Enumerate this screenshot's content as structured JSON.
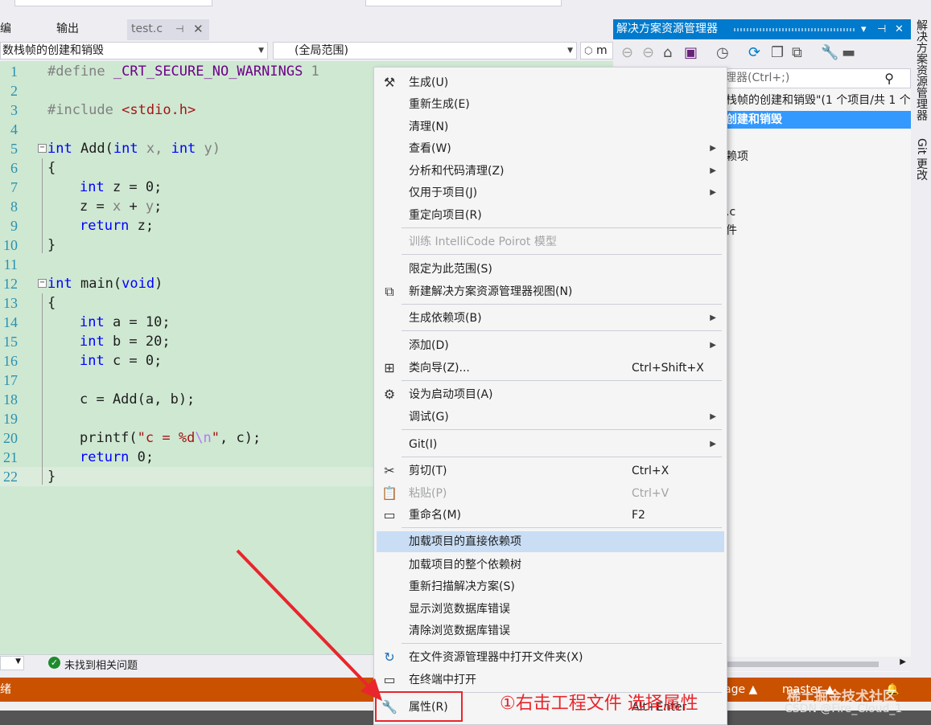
{
  "tabs": {
    "left_partial": "编",
    "output": "输出",
    "active": "test.c",
    "pin_icon": "pin-icon",
    "close_icon": "close-icon"
  },
  "navbar": {
    "project_combo": "数栈帧的创建和销毁",
    "scope_combo": "(全局范围)",
    "member_combo_partial": "m"
  },
  "editor": {
    "lines": [
      {
        "n": "1"
      },
      {
        "n": "2"
      },
      {
        "n": "3"
      },
      {
        "n": "4"
      },
      {
        "n": "5"
      },
      {
        "n": "6"
      },
      {
        "n": "7"
      },
      {
        "n": "8"
      },
      {
        "n": "9"
      },
      {
        "n": "10"
      },
      {
        "n": "11"
      },
      {
        "n": "12"
      },
      {
        "n": "13"
      },
      {
        "n": "14"
      },
      {
        "n": "15"
      },
      {
        "n": "16"
      },
      {
        "n": "17"
      },
      {
        "n": "18"
      },
      {
        "n": "19"
      },
      {
        "n": "20"
      },
      {
        "n": "21"
      },
      {
        "n": "22"
      }
    ],
    "tokens": {
      "define": "#define",
      "macro": "_CRT_SECURE_NO_WARNINGS",
      "one": " 1",
      "include": "#include",
      "header": "<stdio.h>",
      "int": "int",
      "return": "return",
      "void": "void",
      "add_sig_a": " Add(",
      "add_sig_x": " x, ",
      "add_sig_y": " y)",
      "brace_open": "{",
      "brace_close": "}",
      "l7_rest": " z = 0;",
      "l8": "z = ",
      "l8_x": "x",
      "l8_plus": " + ",
      "l8_y": "y",
      "l8_end": ";",
      "l9_rest": " z;",
      "main_a": " main(",
      "main_b": ")",
      "l14_rest": " a = 10;",
      "l15_rest": " b = 20;",
      "l16_rest": " c = 0;",
      "l18": "c = Add(a, b);",
      "l20_a": "printf(",
      "l20_str1": "\"c = %d",
      "l20_esc": "\\n",
      "l20_str2": "\"",
      "l20_b": ", c);",
      "l21_rest": " 0;"
    }
  },
  "editor_bottom": {
    "issues": "未找到相关问题"
  },
  "solution_explorer": {
    "title": "解决方案资源管理器",
    "title_controls": [
      "▾",
      "⊣",
      "✕"
    ],
    "search_placeholder": "理器(Ctrl+;)",
    "rows": [
      "栈帧的创建和销毁\"(1 个项目/共 1 个)",
      "创建和销毁",
      "赖项",
      ".c",
      "件"
    ]
  },
  "vertical_tabs": {
    "solution": "解决方案资源管理器",
    "git": "Git 更改"
  },
  "context_menu": {
    "items": [
      {
        "label": "生成(U)",
        "icon": "build-icon"
      },
      {
        "label": "重新生成(E)"
      },
      {
        "label": "清理(N)"
      },
      {
        "label": "查看(W)",
        "submenu": true
      },
      {
        "label": "分析和代码清理(Z)",
        "submenu": true
      },
      {
        "label": "仅用于项目(J)",
        "submenu": true
      },
      {
        "label": "重定向项目(R)"
      },
      {
        "label": "训练 IntelliCode Poirot 模型",
        "disabled": true
      },
      {
        "label": "限定为此范围(S)"
      },
      {
        "label": "新建解决方案资源管理器视图(N)",
        "icon": "new-view-icon"
      },
      {
        "label": "生成依赖项(B)",
        "submenu": true
      },
      {
        "label": "添加(D)",
        "submenu": true
      },
      {
        "label": "类向导(Z)...",
        "shortcut": "Ctrl+Shift+X",
        "icon": "class-wizard-icon"
      },
      {
        "label": "设为启动项目(A)",
        "icon": "gear-icon"
      },
      {
        "label": "调试(G)",
        "submenu": true
      },
      {
        "label": "Git(I)",
        "submenu": true
      },
      {
        "label": "剪切(T)",
        "shortcut": "Ctrl+X",
        "icon": "scissors-icon"
      },
      {
        "label": "粘贴(P)",
        "shortcut": "Ctrl+V",
        "disabled": true,
        "icon": "paste-icon"
      },
      {
        "label": "重命名(M)",
        "shortcut": "F2",
        "icon": "rename-icon"
      },
      {
        "label": "加载项目的直接依赖项",
        "highlighted": true
      },
      {
        "label": "加载项目的整个依赖树"
      },
      {
        "label": "重新扫描解决方案(S)"
      },
      {
        "label": "显示浏览数据库错误"
      },
      {
        "label": "清除浏览数据库错误"
      },
      {
        "label": "在文件资源管理器中打开文件夹(X)",
        "icon": "open-folder-icon"
      },
      {
        "label": "在终端中打开",
        "icon": "terminal-icon"
      },
      {
        "label": "属性(R)",
        "shortcut": "Alt+Enter",
        "icon": "wrench-icon"
      }
    ]
  },
  "statusbar": {
    "ready": "绪",
    "lang": "age ▲",
    "branch": "master ▲",
    "bell": "🔔"
  },
  "annotation": {
    "text": "①右击工程文件   选择属性",
    "color": "#e8262c"
  },
  "watermark": {
    "text": "稀土掘金技术社区",
    "csdn": "CSDN @Fire_Cloud_1"
  },
  "colors": {
    "accent": "#007acc",
    "status": "#ca5100",
    "editor_bg": "#cfe8d2",
    "menu_highlight": "#c9def5",
    "selection": "#3399ff"
  }
}
